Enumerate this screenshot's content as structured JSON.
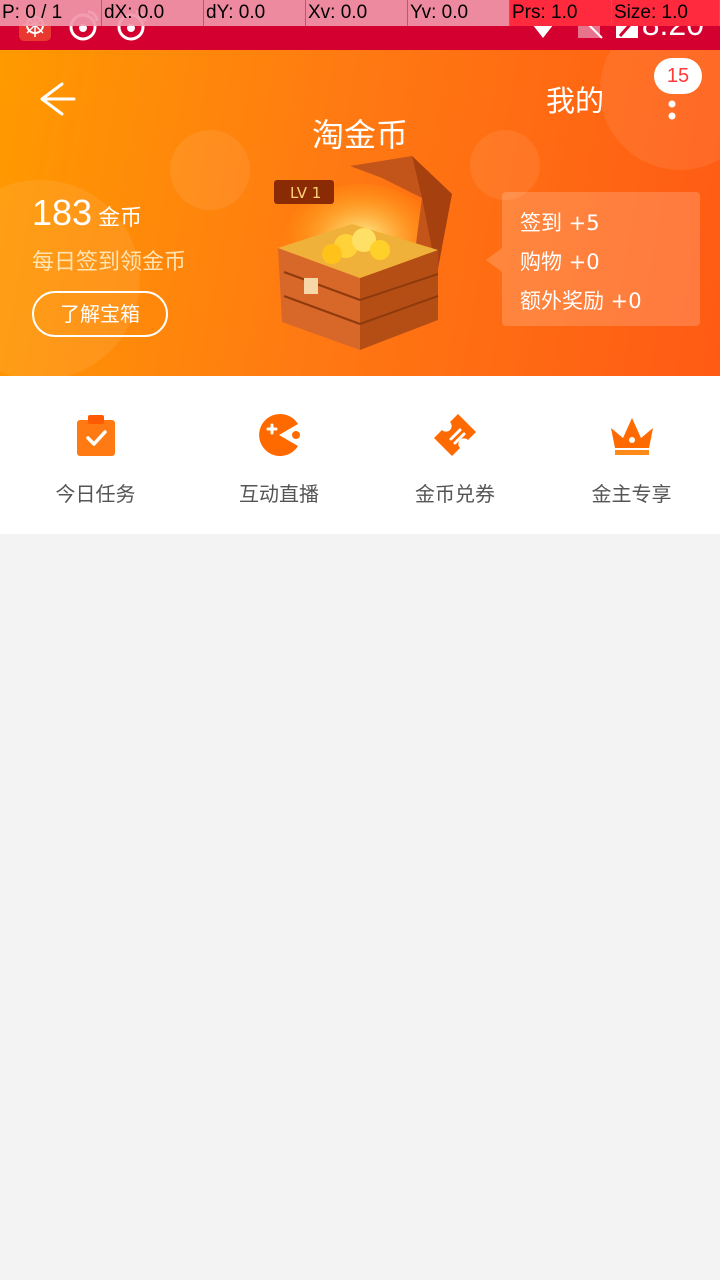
{
  "status_bar": {
    "time": "8:20",
    "debug": [
      "P: 0 / 1",
      "dX: 0.0",
      "dY: 0.0",
      "Xv: 0.0",
      "Yv: 0.0",
      "Prs: 1.0",
      "Size: 1.0"
    ]
  },
  "header": {
    "title": "淘金币",
    "mine_label": "我的",
    "badge_count": "15",
    "coin_count": "183",
    "coin_unit": "金币",
    "subtitle": "每日签到领金币",
    "learn_button": "了解宝箱",
    "chest_level": "LV 1",
    "rewards": [
      "签到 +5",
      "购物 +0",
      "额外奖励 +0"
    ]
  },
  "actions": [
    {
      "label": "今日任务",
      "icon": "clipboard-check-icon"
    },
    {
      "label": "互动直播",
      "icon": "pacman-live-icon"
    },
    {
      "label": "金币兑券",
      "icon": "ticket-icon"
    },
    {
      "label": "金主专享",
      "icon": "crown-icon"
    }
  ],
  "colors": {
    "status_bar": "#d4002f",
    "header_start": "#ff9a00",
    "header_end": "#ff5a14",
    "icon_orange": "#ff6a00",
    "background": "#f3f3f3"
  }
}
